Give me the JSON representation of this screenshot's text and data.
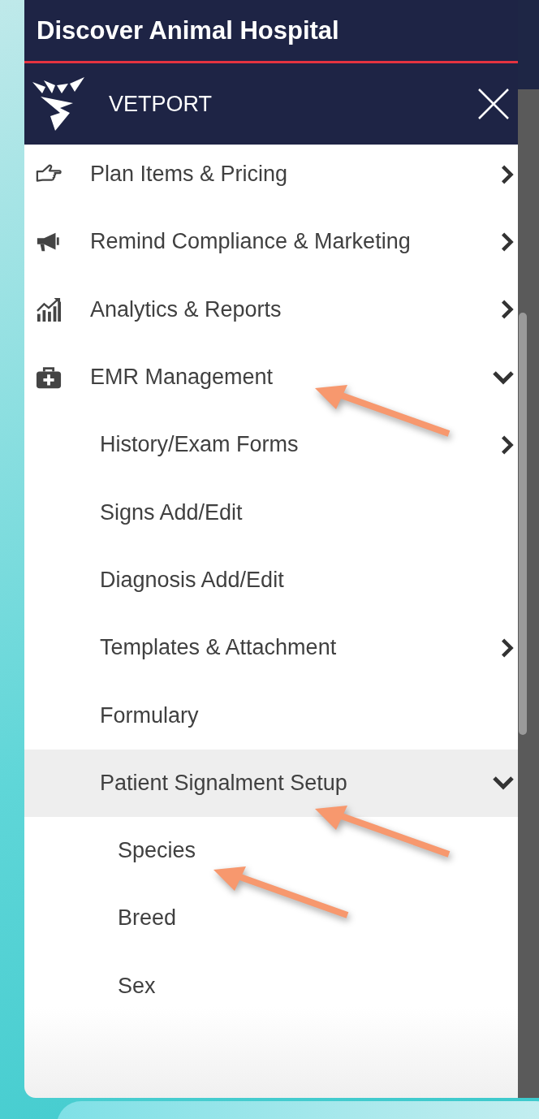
{
  "header": {
    "title": "Discover Animal Hospital",
    "brand": "VETPORT"
  },
  "menu": [
    {
      "label": "Plan Items & Pricing",
      "kind": "submenu",
      "selected": false
    },
    {
      "label": "Remind Compliance & Marketing",
      "kind": "submenu",
      "selected": false
    },
    {
      "label": "Analytics & Reports",
      "kind": "submenu",
      "selected": false
    },
    {
      "label": "EMR Management",
      "kind": "group",
      "expanded": true,
      "selected": false,
      "children": [
        {
          "label": "History/Exam Forms",
          "kind": "submenu",
          "selected": false
        },
        {
          "label": "Signs Add/Edit",
          "kind": "link",
          "selected": false
        },
        {
          "label": "Diagnosis Add/Edit",
          "kind": "link",
          "selected": false
        },
        {
          "label": "Templates & Attachment",
          "kind": "submenu",
          "selected": false
        },
        {
          "label": "Formulary",
          "kind": "link",
          "selected": false
        },
        {
          "label": "Patient Signalment Setup",
          "kind": "group",
          "expanded": true,
          "selected": true,
          "children": [
            {
              "label": "Species",
              "kind": "link",
              "selected": false
            },
            {
              "label": "Breed",
              "kind": "link",
              "selected": false
            },
            {
              "label": "Sex",
              "kind": "link",
              "selected": false
            }
          ]
        }
      ]
    }
  ]
}
